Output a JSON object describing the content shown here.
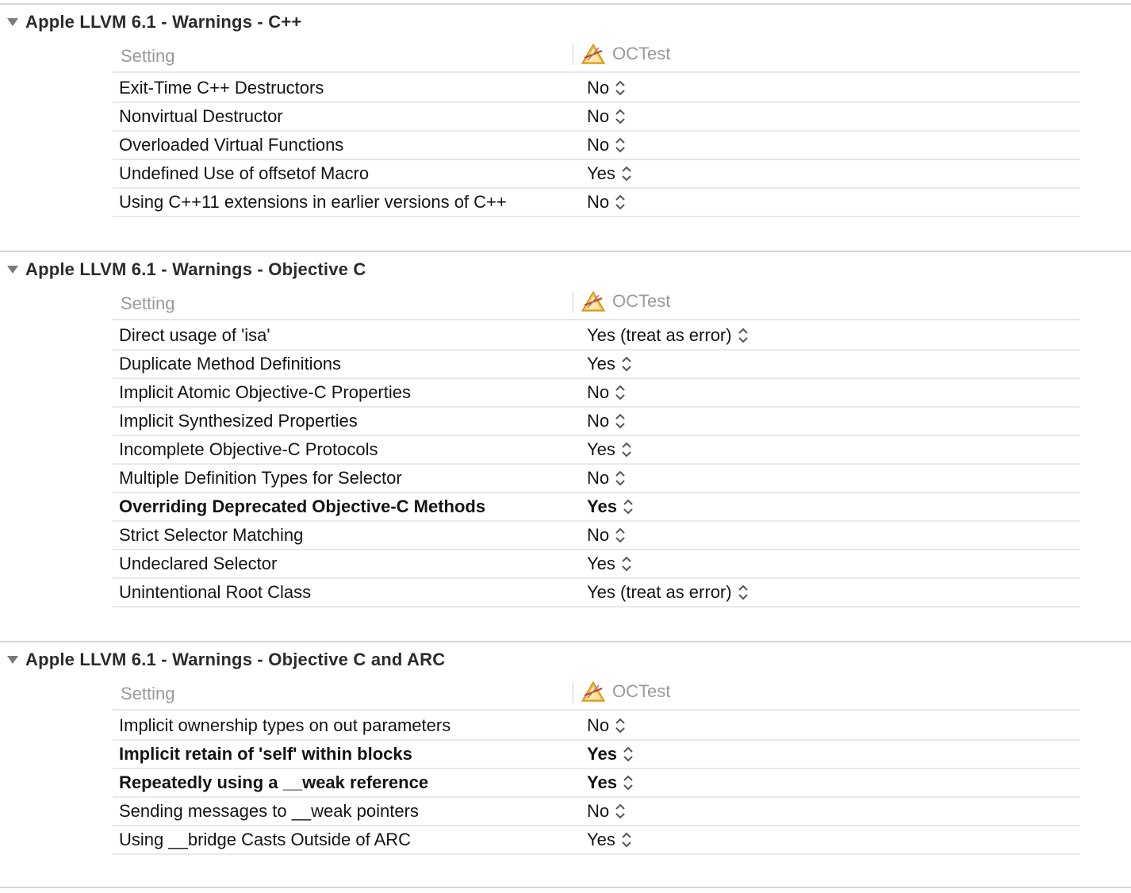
{
  "target_name": "OCTest",
  "setting_header": "Setting",
  "sections": [
    {
      "title": "Apple LLVM 6.1 - Warnings - C++",
      "rows": [
        {
          "name": "Exit-Time C++ Destructors",
          "value": "No",
          "bold": false
        },
        {
          "name": "Nonvirtual Destructor",
          "value": "No",
          "bold": false
        },
        {
          "name": "Overloaded Virtual Functions",
          "value": "No",
          "bold": false
        },
        {
          "name": "Undefined Use of offsetof Macro",
          "value": "Yes",
          "bold": false
        },
        {
          "name": "Using C++11 extensions in earlier versions of C++",
          "value": "No",
          "bold": false
        }
      ]
    },
    {
      "title": "Apple LLVM 6.1 - Warnings - Objective C",
      "rows": [
        {
          "name": "Direct usage of 'isa'",
          "value": "Yes (treat as error)",
          "bold": false
        },
        {
          "name": "Duplicate Method Definitions",
          "value": "Yes",
          "bold": false
        },
        {
          "name": "Implicit Atomic Objective-C Properties",
          "value": "No",
          "bold": false
        },
        {
          "name": "Implicit Synthesized Properties",
          "value": "No",
          "bold": false
        },
        {
          "name": "Incomplete Objective-C Protocols",
          "value": "Yes",
          "bold": false
        },
        {
          "name": "Multiple Definition Types for Selector",
          "value": "No",
          "bold": false
        },
        {
          "name": "Overriding Deprecated Objective-C Methods",
          "value": "Yes",
          "bold": true
        },
        {
          "name": "Strict Selector Matching",
          "value": "No",
          "bold": false
        },
        {
          "name": "Undeclared Selector",
          "value": "Yes",
          "bold": false
        },
        {
          "name": "Unintentional Root Class",
          "value": "Yes (treat as error)",
          "bold": false
        }
      ]
    },
    {
      "title": "Apple LLVM 6.1 - Warnings - Objective C and ARC",
      "rows": [
        {
          "name": "Implicit ownership types on out parameters",
          "value": "No",
          "bold": false
        },
        {
          "name": "Implicit retain of 'self' within blocks",
          "value": "Yes",
          "bold": true
        },
        {
          "name": "Repeatedly using a __weak reference",
          "value": "Yes",
          "bold": true
        },
        {
          "name": "Sending messages to __weak pointers",
          "value": "No",
          "bold": false
        },
        {
          "name": "Using __bridge Casts Outside of ARC",
          "value": "Yes",
          "bold": false
        }
      ]
    }
  ]
}
